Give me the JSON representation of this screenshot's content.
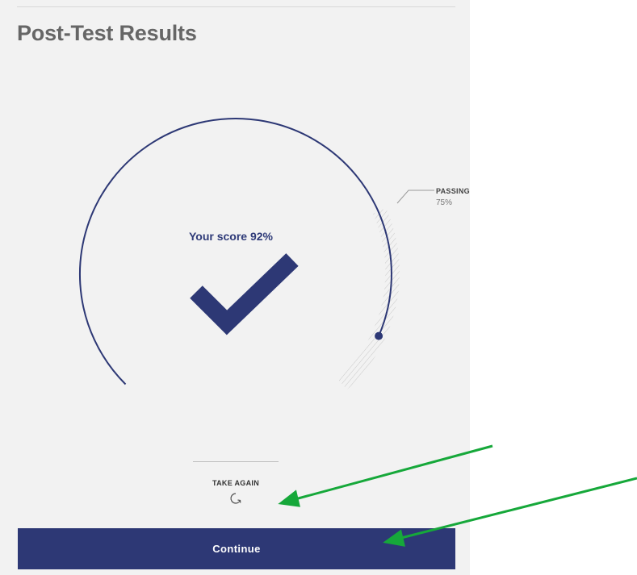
{
  "page": {
    "title": "Post-Test Results"
  },
  "result": {
    "score_label": "Your score 92%",
    "score_percent": 92,
    "passing_label": "PASSING",
    "passing_value": "75%",
    "passing_percent": 75
  },
  "actions": {
    "take_again_label": "TAKE AGAIN",
    "continue_label": "Continue"
  },
  "colors": {
    "accent": "#2d3875",
    "annotation_arrow": "#16a83a",
    "panel_background": "#f2f2f2"
  },
  "icons": {
    "retry": "retry-icon",
    "checkmark": "checkmark-icon"
  }
}
